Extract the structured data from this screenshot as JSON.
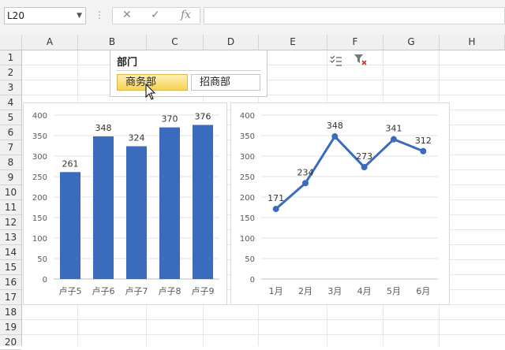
{
  "name_box": {
    "value": "L20"
  },
  "formula_bar": {
    "cancel_icon": "✕",
    "enter_icon": "✓",
    "fx_label": "fx",
    "dots": "⋮",
    "value": ""
  },
  "columns": [
    "A",
    "B",
    "C",
    "D",
    "E",
    "F",
    "G",
    "H"
  ],
  "rows": [
    "1",
    "2",
    "3",
    "4",
    "5",
    "6",
    "7",
    "8",
    "9",
    "10",
    "11",
    "12",
    "13",
    "14",
    "15",
    "16",
    "17",
    "18",
    "19",
    "20"
  ],
  "slicer": {
    "title": "部门",
    "items": [
      {
        "label": "商务部",
        "selected": true
      },
      {
        "label": "招商部",
        "selected": false
      }
    ],
    "icons": [
      "multi-select-icon",
      "clear-filter-icon"
    ]
  },
  "chart_data": [
    {
      "type": "bar",
      "categories": [
        "卢子5",
        "卢子6",
        "卢子7",
        "卢子8",
        "卢子9"
      ],
      "values": [
        261,
        348,
        324,
        370,
        376
      ],
      "yticks": [
        0,
        50,
        100,
        150,
        200,
        250,
        300,
        350,
        400
      ],
      "ylim": [
        0,
        400
      ],
      "color": "#3a6bbd",
      "grid": true,
      "legend": "none"
    },
    {
      "type": "line",
      "categories": [
        "1月",
        "2月",
        "3月",
        "4月",
        "5月",
        "6月"
      ],
      "values": [
        171,
        234,
        348,
        273,
        341,
        312
      ],
      "yticks": [
        0,
        50,
        100,
        150,
        200,
        250,
        300,
        350,
        400
      ],
      "ylim": [
        0,
        400
      ],
      "color": "#3a6bbd",
      "grid": true,
      "legend": "none"
    }
  ]
}
